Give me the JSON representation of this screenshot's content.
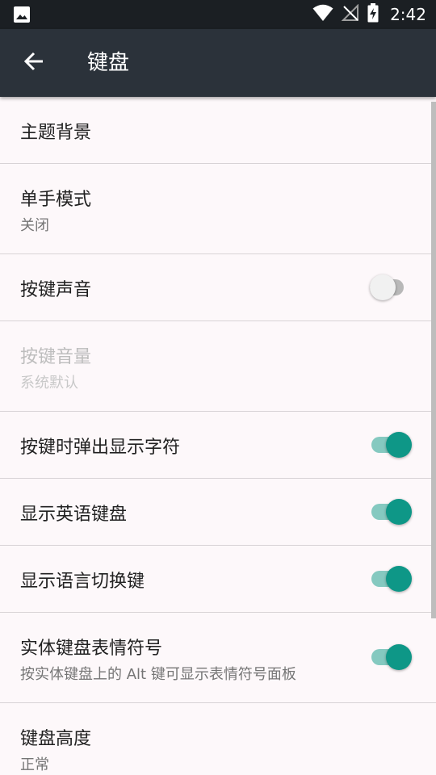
{
  "status_bar": {
    "time": "2:42",
    "icons": [
      "gallery-icon",
      "wifi-icon",
      "no-signal-icon",
      "battery-charging-icon"
    ]
  },
  "app_bar": {
    "title": "键盘",
    "back_icon": "arrow-left-icon"
  },
  "settings": [
    {
      "title": "主题背景",
      "summary": null,
      "toggle": null,
      "enabled": true
    },
    {
      "title": "单手模式",
      "summary": "关闭",
      "toggle": null,
      "enabled": true
    },
    {
      "title": "按键声音",
      "summary": null,
      "toggle": false,
      "enabled": true
    },
    {
      "title": "按键音量",
      "summary": "系统默认",
      "toggle": null,
      "enabled": false
    },
    {
      "title": "按键时弹出显示字符",
      "summary": null,
      "toggle": true,
      "enabled": true
    },
    {
      "title": "显示英语键盘",
      "summary": null,
      "toggle": true,
      "enabled": true
    },
    {
      "title": "显示语言切换键",
      "summary": null,
      "toggle": true,
      "enabled": true
    },
    {
      "title": "实体键盘表情符号",
      "summary": "按实体键盘上的 Alt 键可显示表情符号面板",
      "toggle": true,
      "enabled": true
    },
    {
      "title": "键盘高度",
      "summary": "正常",
      "toggle": null,
      "enabled": true
    }
  ],
  "colors": {
    "status_bar": "#1b1f23",
    "app_bar": "#2b323a",
    "background": "#fdf8fa",
    "switch_on_thumb": "#0e9787",
    "switch_on_track": "#85c9c0",
    "switch_off_thumb": "#f1f1f1",
    "switch_off_track": "#b8b8b8"
  }
}
